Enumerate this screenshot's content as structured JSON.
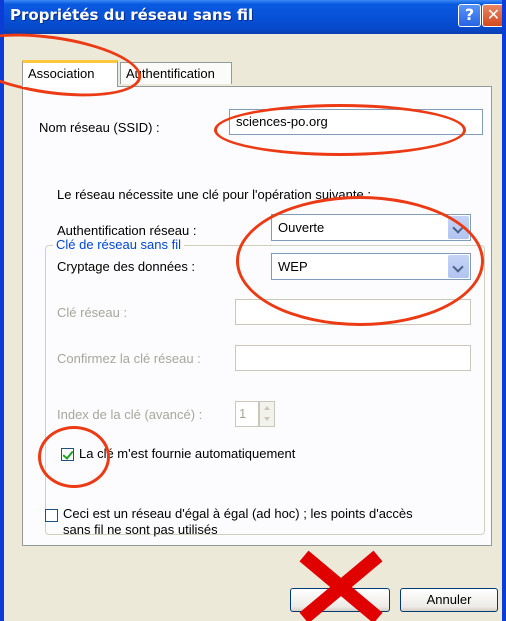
{
  "window": {
    "title": "Propriétés du réseau sans fil",
    "help_label": "?",
    "close_label": "✕"
  },
  "tabs": [
    {
      "label": "Association",
      "active": true
    },
    {
      "label": "Authentification",
      "active": false
    }
  ],
  "association": {
    "ssid_label": "Nom réseau (SSID) :",
    "ssid_value": "sciences-po.org",
    "group_title": "Clé de réseau sans fil",
    "key_required_text": "Le réseau nécessite une clé pour l'opération suivante :",
    "auth_label": "Authentification réseau :",
    "auth_value": "Ouverte",
    "encryption_label": "Cryptage des données :",
    "encryption_value": "WEP",
    "network_key_label": "Clé réseau :",
    "network_key_value": "",
    "confirm_key_label": "Confirmez la clé réseau :",
    "confirm_key_value": "",
    "key_index_label": "Index de la clé (avancé) :",
    "key_index_value": "1",
    "auto_key_label": "La clé m'est fournie automatiquement",
    "auto_key_checked": true,
    "adhoc_label_line1": "Ceci est un réseau d'égal à égal (ad hoc) ; les points d'accès",
    "adhoc_label_line2": "sans fil ne sont pas utilisés",
    "adhoc_checked": false
  },
  "buttons": {
    "ok_label": "",
    "cancel_label": "Annuler"
  },
  "colors": {
    "title_bar": "#0750d6",
    "annotation_red": "#ec3a14",
    "group_title": "#0046d5"
  }
}
